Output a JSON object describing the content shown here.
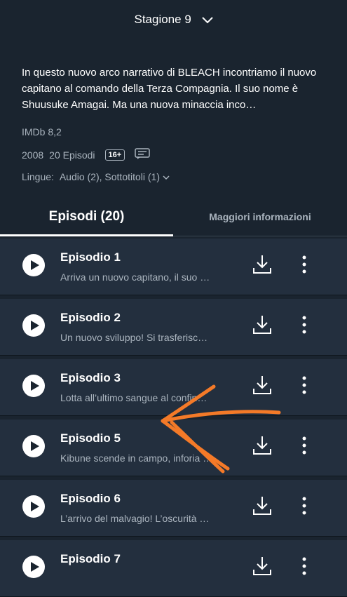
{
  "season": {
    "label": "Stagione 9"
  },
  "description": "In questo nuovo arco narrativo di BLEACH incontriamo il nuovo capitano al comando della Terza Compagnia. Il suo nome è Shuusuke Amagai. Ma una nuova minaccia inco…",
  "meta": {
    "imdb": "IMDb 8,2",
    "year": "2008",
    "episodes": "20 Episodi",
    "rating": "16+",
    "languages_label": "Lingue:",
    "languages_value": "Audio (2), Sottotitoli (1)"
  },
  "tabs": [
    {
      "label": "Episodi (20)",
      "active": true
    },
    {
      "label": "Maggiori informazioni",
      "active": false
    }
  ],
  "episodes": [
    {
      "title": "Episodio 1",
      "subtitle": "Arriva un nuovo capitano, il suo …"
    },
    {
      "title": "Episodio 2",
      "subtitle": "Un nuovo sviluppo! Si trasferisc…"
    },
    {
      "title": "Episodio 3",
      "subtitle": "Lotta all’ultimo sangue al confin…"
    },
    {
      "title": "Episodio 5",
      "subtitle": "Kibune scende in campo, inforia …"
    },
    {
      "title": "Episodio 6",
      "subtitle": "L’arrivo del malvagio! L’oscurità …"
    },
    {
      "title": "Episodio 7",
      "subtitle": ""
    }
  ],
  "colors": {
    "background": "#1a242f",
    "row": "#232f3e",
    "muted": "#aab4be",
    "annotation": "#f47a28"
  },
  "icons": [
    "chevron-down-icon",
    "play-icon",
    "download-icon",
    "more-vertical-icon",
    "subtitles-icon",
    "arrow-annotation"
  ]
}
